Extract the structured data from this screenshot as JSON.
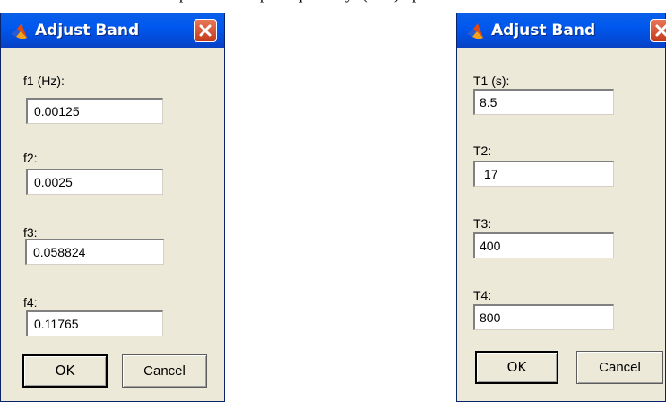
{
  "caption_fragment": [
    "p",
    "p",
    "q",
    "y",
    "(",
    ")",
    "p"
  ],
  "left_dialog": {
    "title": "Adjust Band",
    "fields": [
      {
        "label": "f1 (Hz):",
        "value": "0.00125"
      },
      {
        "label": "f2:",
        "value": "0.0025"
      },
      {
        "label": "f3:",
        "value": "0.058824"
      },
      {
        "label": "f4:",
        "value": "0.11765"
      }
    ],
    "ok_label": "OK",
    "cancel_label": "Cancel"
  },
  "right_dialog": {
    "title": "Adjust Band",
    "fields": [
      {
        "label": "T1 (s):",
        "value": "8.5"
      },
      {
        "label": "T2:",
        "value": "17"
      },
      {
        "label": "T3:",
        "value": "400"
      },
      {
        "label": "T4:",
        "value": "800"
      }
    ],
    "ok_label": "OK",
    "cancel_label": "Cancel"
  },
  "icons": {
    "app": "matlab-logo-icon",
    "close": "close-x-icon"
  },
  "colors": {
    "titlebar": "#0058ee",
    "dialog_bg": "#ece9d8",
    "close_button": "#d5512e"
  }
}
